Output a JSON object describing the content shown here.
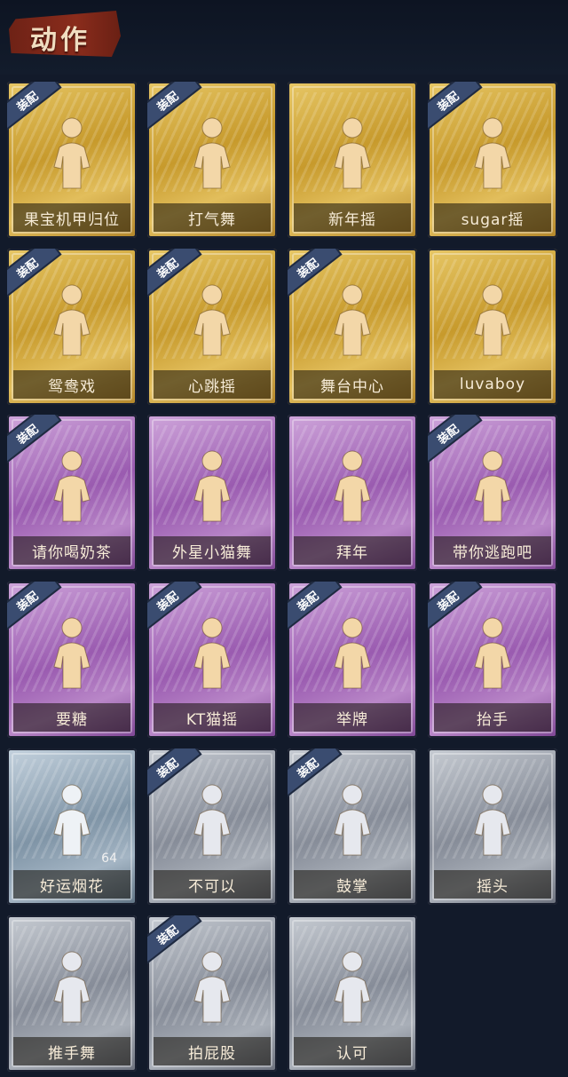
{
  "header": {
    "title": "动作"
  },
  "equip_badge": "装配",
  "colors": {
    "gold": "#d6ae44",
    "purple": "#a86abd",
    "silver": "#9aa0aa",
    "blue": "#8fa3b4",
    "background": "#121a2a"
  },
  "actions": [
    {
      "label": "果宝机甲归位",
      "rarity": "gold",
      "equipped": true
    },
    {
      "label": "打气舞",
      "rarity": "gold",
      "equipped": true
    },
    {
      "label": "新年摇",
      "rarity": "gold",
      "equipped": false
    },
    {
      "label": "sugar摇",
      "rarity": "gold",
      "equipped": true
    },
    {
      "label": "鸳鸯戏",
      "rarity": "gold",
      "equipped": true
    },
    {
      "label": "心跳摇",
      "rarity": "gold",
      "equipped": true
    },
    {
      "label": "舞台中心",
      "rarity": "gold",
      "equipped": true
    },
    {
      "label": "luvaboy",
      "rarity": "gold",
      "equipped": false
    },
    {
      "label": "请你喝奶茶",
      "rarity": "purple",
      "equipped": true
    },
    {
      "label": "外星小猫舞",
      "rarity": "purple",
      "equipped": false
    },
    {
      "label": "拜年",
      "rarity": "purple",
      "equipped": false
    },
    {
      "label": "带你逃跑吧",
      "rarity": "purple",
      "equipped": true
    },
    {
      "label": "要糖",
      "rarity": "purple",
      "equipped": true
    },
    {
      "label": "KT猫摇",
      "rarity": "purple",
      "equipped": true
    },
    {
      "label": "举牌",
      "rarity": "purple",
      "equipped": true
    },
    {
      "label": "抬手",
      "rarity": "purple",
      "equipped": true
    },
    {
      "label": "好运烟花",
      "rarity": "blue",
      "equipped": false,
      "count": "64"
    },
    {
      "label": "不可以",
      "rarity": "silver",
      "equipped": true
    },
    {
      "label": "鼓掌",
      "rarity": "silver",
      "equipped": true
    },
    {
      "label": "摇头",
      "rarity": "silver",
      "equipped": false
    },
    {
      "label": "推手舞",
      "rarity": "silver",
      "equipped": false
    },
    {
      "label": "拍屁股",
      "rarity": "silver",
      "equipped": true
    },
    {
      "label": "认可",
      "rarity": "silver",
      "equipped": false
    }
  ]
}
